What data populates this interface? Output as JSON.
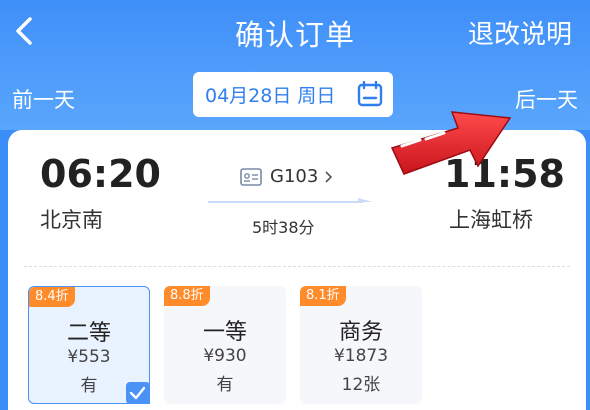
{
  "header": {
    "title": "确认订单",
    "refund_label": "退改说明",
    "back_icon": "chevron-left-icon"
  },
  "date_nav": {
    "prev_label": "前一天",
    "next_label": "后一天",
    "date_text": "04月28日 周日",
    "calendar_icon": "calendar-icon"
  },
  "trip": {
    "departure_time": "06:20",
    "departure_station": "北京南",
    "arrival_time": "11:58",
    "arrival_station": "上海虹桥",
    "train_no": "G103",
    "duration": "5时38分"
  },
  "seats": [
    {
      "discount": "8.4折",
      "name": "二等",
      "price": "¥553",
      "availability": "有",
      "selected": true
    },
    {
      "discount": "8.8折",
      "name": "一等",
      "price": "¥930",
      "availability": "有",
      "selected": false
    },
    {
      "discount": "8.1折",
      "name": "商务",
      "price": "¥1873",
      "availability": "12张",
      "selected": false
    }
  ],
  "colors": {
    "header_blue": "#3f8ff9",
    "accent_blue": "#2f7ff0",
    "discount_orange": "#ff8b2b",
    "annotation_red": "#e8212a"
  }
}
